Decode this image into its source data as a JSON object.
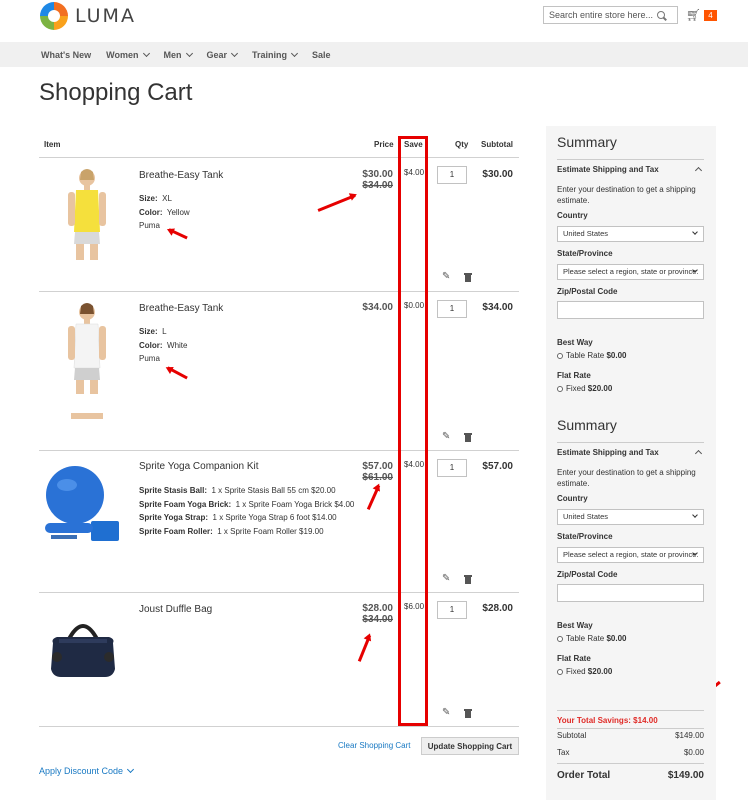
{
  "header": {
    "logo_text": "LUMA",
    "search_placeholder": "Search entire store here...",
    "cart_count": "4"
  },
  "nav": {
    "items": [
      "What's New",
      "Women",
      "Men",
      "Gear",
      "Training",
      "Sale"
    ]
  },
  "page_title": "Shopping Cart",
  "table": {
    "headers": {
      "item": "Item",
      "price": "Price",
      "save": "Save",
      "qty": "Qty",
      "subtotal": "Subtotal"
    },
    "items": [
      {
        "name": "Breathe-Easy Tank",
        "options": [
          {
            "label": "Size:",
            "value": "XL"
          },
          {
            "label": "Color:",
            "value": "Yellow"
          }
        ],
        "brand": "Puma",
        "price": "$30.00",
        "old_price": "$34.00",
        "save": "$4.00",
        "qty": "1",
        "subtotal": "$30.00"
      },
      {
        "name": "Breathe-Easy Tank",
        "options": [
          {
            "label": "Size:",
            "value": "L"
          },
          {
            "label": "Color:",
            "value": "White"
          }
        ],
        "brand": "Puma",
        "price": "$34.00",
        "save": "$0.00",
        "qty": "1",
        "subtotal": "$34.00"
      },
      {
        "name": "Sprite Yoga Companion Kit",
        "bundle": [
          {
            "label": "Sprite Stasis Ball:",
            "value": "1 x Sprite Stasis Ball 55 cm $20.00"
          },
          {
            "label": "Sprite Foam Yoga Brick:",
            "value": "1 x Sprite Foam Yoga Brick $4.00"
          },
          {
            "label": "Sprite Yoga Strap:",
            "value": "1 x Sprite Yoga Strap 6 foot $14.00"
          },
          {
            "label": "Sprite Foam Roller:",
            "value": "1 x Sprite Foam Roller $19.00"
          }
        ],
        "price": "$57.00",
        "old_price": "$61.00",
        "save": "$4.00",
        "qty": "1",
        "subtotal": "$57.00"
      },
      {
        "name": "Joust Duffle Bag",
        "price": "$28.00",
        "old_price": "$34.00",
        "save": "$6.00",
        "qty": "1",
        "subtotal": "$28.00"
      }
    ]
  },
  "actions": {
    "clear_cart": "Clear Shopping Cart",
    "update_cart": "Update Shopping Cart",
    "apply_discount": "Apply Discount Code"
  },
  "summary": {
    "title": "Summary",
    "estimate_title": "Estimate Shipping and Tax",
    "estimate_text": "Enter your destination to get a shipping estimate.",
    "country_label": "Country",
    "country_value": "United States",
    "state_label": "State/Province",
    "state_placeholder": "Please select a region, state or province.",
    "zip_label": "Zip/Postal Code",
    "best_way_label": "Best Way",
    "best_way_option": "Table Rate",
    "best_way_price": "$0.00",
    "flat_rate_label": "Flat Rate",
    "flat_rate_option": "Fixed",
    "flat_rate_price": "$20.00",
    "total_savings_label": "Your Total Savings:",
    "total_savings_value": "$14.00",
    "subtotal_label": "Subtotal",
    "subtotal_value": "$149.00",
    "tax_label": "Tax",
    "tax_value": "$0.00",
    "order_total_label": "Order Total",
    "order_total_value": "$149.00"
  },
  "colors": {
    "accent_red": "#e60000",
    "link_blue": "#1979c3",
    "savings_red": "#e02b27",
    "cart_badge": "#ff5501"
  }
}
